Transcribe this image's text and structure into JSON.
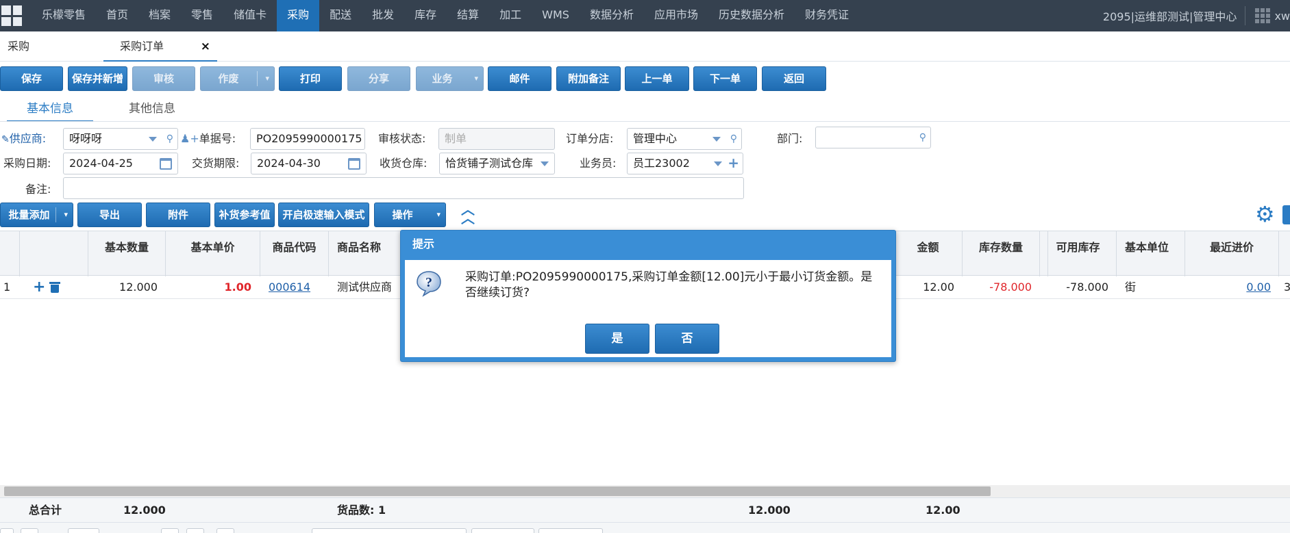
{
  "topnav": {
    "items": [
      "乐檬零售",
      "首页",
      "档案",
      "零售",
      "储值卡",
      "采购",
      "配送",
      "批发",
      "库存",
      "结算",
      "加工",
      "WMS",
      "数据分析",
      "应用市场",
      "历史数据分析",
      "财务凭证"
    ],
    "active_index": 5,
    "user_info": "2095|运维部测试|管理中心",
    "user_short": "xw"
  },
  "page_tabs": {
    "tab1": "采购",
    "tab2": "采购订单",
    "close_glyph": "×"
  },
  "toolbar": {
    "save": "保存",
    "save_new": "保存并新增",
    "audit": "审核",
    "void": "作废",
    "print": "打印",
    "share": "分享",
    "business": "业务",
    "email": "邮件",
    "add_note": "附加备注",
    "prev": "上一单",
    "next": "下一单",
    "back": "返回"
  },
  "info_tabs": {
    "basic": "基本信息",
    "other": "其他信息"
  },
  "form": {
    "supplier_label": "供应商:",
    "supplier_value": "呀呀呀",
    "doc_no_label": "单据号:",
    "doc_no_value": "PO2095990000175",
    "audit_status_label": "审核状态:",
    "audit_status_value": "制单",
    "order_branch_label": "订单分店:",
    "order_branch_value": "管理中心",
    "dept_label": "部门:",
    "dept_value": "",
    "purchase_date_label": "采购日期:",
    "purchase_date_value": "2024-04-25",
    "delivery_limit_label": "交货期限:",
    "delivery_limit_value": "2024-04-30",
    "warehouse_label": "收货仓库:",
    "warehouse_value": "恰货铺子测试仓库",
    "salesman_label": "业务员:",
    "salesman_value": "员工23002",
    "remark_label": "备注:",
    "remark_value": ""
  },
  "grid_toolbar": {
    "batch_add": "批量添加",
    "export": "导出",
    "attachment": "附件",
    "restock_ref": "补货参考值",
    "fast_input": "开启极速输入模式",
    "operation": "操作"
  },
  "grid": {
    "headers": {
      "base_qty": "基本数量",
      "base_price": "基本单价",
      "product_code": "商品代码",
      "product_name": "商品名称",
      "amount": "金额",
      "stock_qty": "库存数量",
      "available_stock": "可用库存",
      "base_unit": "基本单位",
      "recent_price": "最近进价"
    },
    "rows": [
      {
        "index": "1",
        "base_qty": "12.000",
        "base_price": "1.00",
        "product_code": "000614",
        "product_name": "测试供应商",
        "amount": "12.00",
        "stock_qty": "-78.000",
        "available_stock": "-78.000",
        "base_unit": "街",
        "recent_price": "0.00",
        "overflow": "3"
      }
    ]
  },
  "footer": {
    "total_label": "总合计",
    "total_qty": "12.000",
    "item_count": "货品数: 1",
    "sum1": "12.000",
    "sum2": "12.00"
  },
  "dialog": {
    "title": "提示",
    "message": "采购订单:PO2095990000175,采购订单金额[12.00]元小于最小订货金额。是否继续订货?",
    "yes": "是",
    "no": "否"
  },
  "colors": {
    "nav_bg": "#35414f",
    "accent": "#1f6fb5",
    "negative": "#e0262b"
  }
}
